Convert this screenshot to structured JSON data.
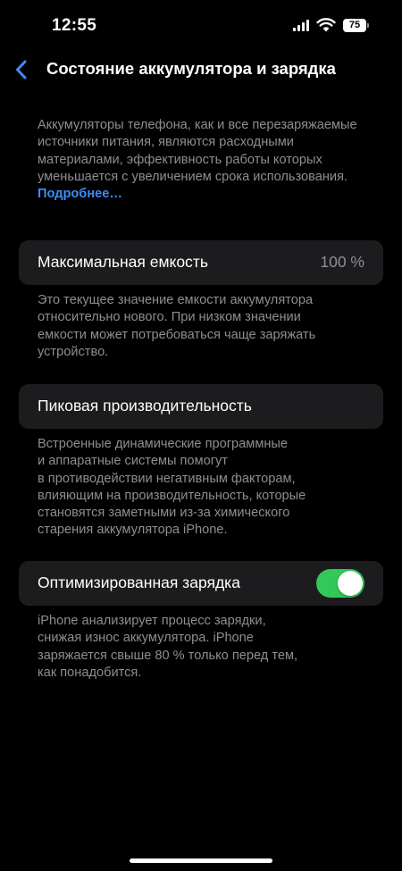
{
  "status_bar": {
    "time": "12:55",
    "battery_level": "75",
    "icons": [
      "cellular-signal-icon",
      "wifi-icon",
      "battery-icon"
    ]
  },
  "nav": {
    "back_icon": "chevron-left-icon",
    "title": "Состояние аккумулятора и зарядка"
  },
  "intro": {
    "text": "Аккумуляторы телефона, как и все перезаряжаемые источники питания, являются расходными материалами, эффективность работы которых уменьшается с увеличением срока использования.",
    "link": "Подробнее…"
  },
  "max_capacity": {
    "label": "Максимальная емкость",
    "value": "100 %",
    "footnote": "Это текущее значение емкости аккумулятора\nотносительно нового. При низком значении\nемкости может потребоваться чаще заряжать\nустройство."
  },
  "peak_performance": {
    "label": "Пиковая производительность",
    "footnote": "Встроенные динамические программные\nи аппаратные системы помогут\nв противодействии негативным факторам,\nвлияющим на производительность, которые\nстановятся заметными из-за химического\nстарения аккумулятора iPhone."
  },
  "optimized_charging": {
    "label": "Оптимизированная зарядка",
    "enabled": true,
    "footnote": "iPhone анализирует процесс зарядки,\nснижая износ аккумулятора. iPhone\nзаряжается свыше 80 % только перед тем,\nкак понадобится."
  },
  "colors": {
    "background": "#000000",
    "card": "#1c1c1e",
    "secondary_text": "#8e8e93",
    "link": "#3b8df7",
    "toggle_on": "#34c759"
  }
}
